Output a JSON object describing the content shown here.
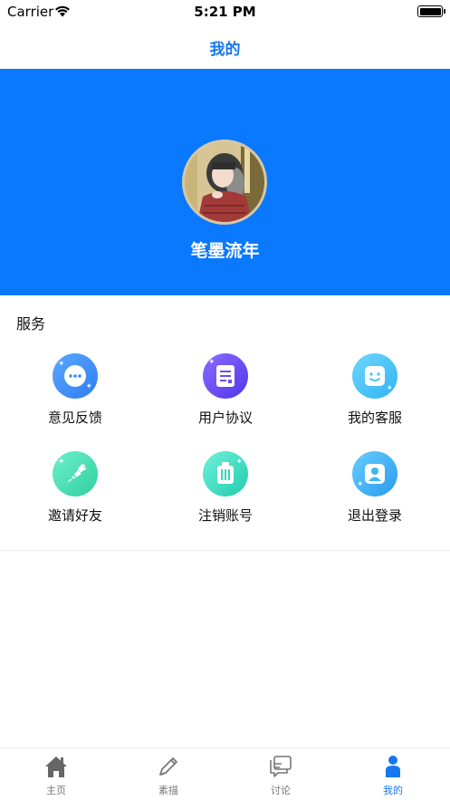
{
  "status_bar": {
    "carrier": "Carrier",
    "time": "5:21 PM"
  },
  "nav": {
    "title": "我的"
  },
  "profile": {
    "username": "笔墨流年"
  },
  "services": {
    "title": "服务",
    "items": [
      {
        "label": "意见反馈",
        "icon": "chat-bubble-icon",
        "color": "#3d8ef5"
      },
      {
        "label": "用户协议",
        "icon": "document-icon",
        "color": "#6b4ff0"
      },
      {
        "label": "我的客服",
        "icon": "smiley-icon",
        "color": "#45c4f7"
      },
      {
        "label": "邀请好友",
        "icon": "carrot-icon",
        "color": "#3fd9b1"
      },
      {
        "label": "注销账号",
        "icon": "trash-bin-icon",
        "color": "#33d8b8"
      },
      {
        "label": "退出登录",
        "icon": "user-icon",
        "color": "#3ab7f5"
      }
    ]
  },
  "tab_bar": {
    "tabs": [
      {
        "label": "主页",
        "icon": "home-icon",
        "active": false
      },
      {
        "label": "素描",
        "icon": "pencil-icon",
        "active": false
      },
      {
        "label": "讨论",
        "icon": "discussion-icon",
        "active": false
      },
      {
        "label": "我的",
        "icon": "person-icon",
        "active": true
      }
    ],
    "active_color": "#1677ee",
    "inactive_color": "#777777"
  },
  "colors": {
    "header_bg": "#0a78ff",
    "accent": "#1677ee"
  }
}
